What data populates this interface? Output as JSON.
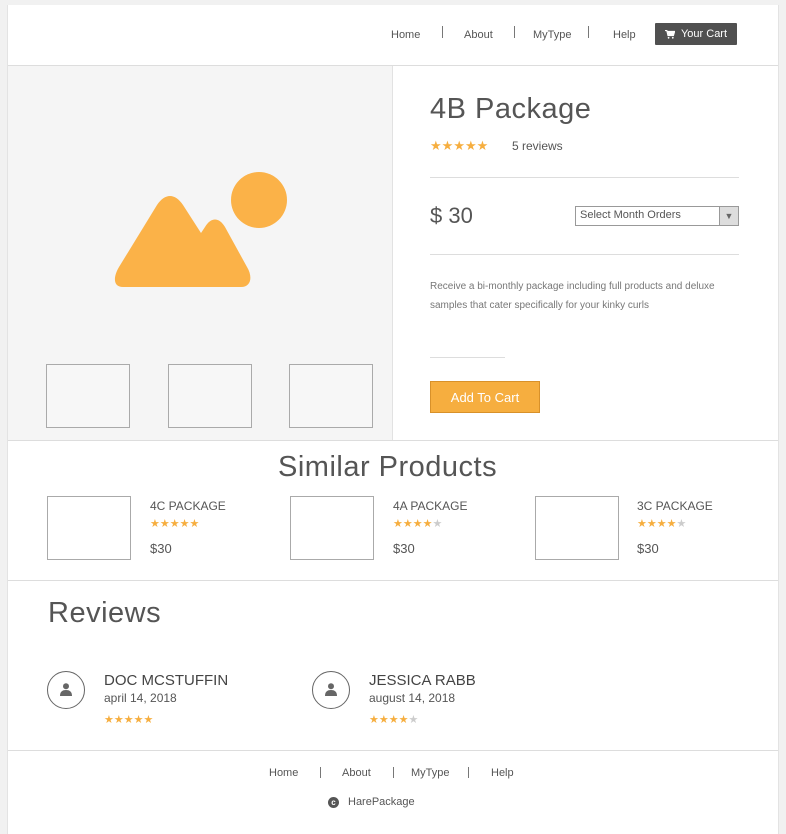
{
  "header": {
    "nav": [
      "Home",
      "About",
      "MyType",
      "Help"
    ],
    "cart_label": "Your Cart"
  },
  "product": {
    "title": "4B Package",
    "rating": 5,
    "reviews_label": "5 reviews",
    "price": "$ 30",
    "select_placeholder": "Select Month Orders",
    "description": "Receive a bi-monthly package including full products and deluxe samples that cater specifically for your kinky curls",
    "add_to_cart_label": "Add To Cart"
  },
  "similar": {
    "title": "Similar Products",
    "items": [
      {
        "name": "4C PACKAGE",
        "rating": 5,
        "price": "$30"
      },
      {
        "name": "4A PACKAGE",
        "rating": 4,
        "price": "$30"
      },
      {
        "name": "3C PACKAGE",
        "rating": 4,
        "price": "$30"
      }
    ]
  },
  "reviews": {
    "title": "Reviews",
    "items": [
      {
        "name": "DOC MCSTUFFIN",
        "date": "april 14, 2018",
        "rating": 5
      },
      {
        "name": "JESSICA  RABB",
        "date": "august 14, 2018",
        "rating": 4
      }
    ]
  },
  "footer": {
    "nav": [
      "Home",
      "About",
      "MyType",
      "Help"
    ],
    "copyright": "HarePackage"
  },
  "colors": {
    "accent": "#f6ae3f",
    "cart_button": "#505050",
    "star_off": "#cccccc"
  }
}
